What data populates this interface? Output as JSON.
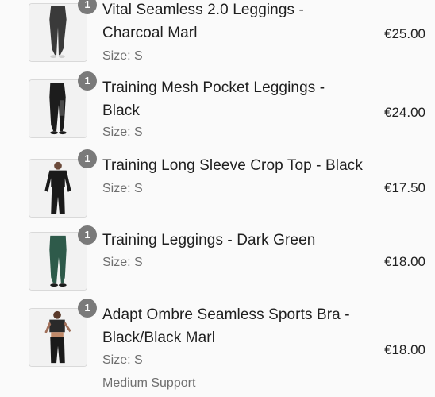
{
  "cart": {
    "items": [
      {
        "title": "Vital Seamless 2.0 Leggings - Charcoal Marl",
        "size": "Size: S",
        "price": "€25.00",
        "quantity": "1",
        "extra": ""
      },
      {
        "title": "Training Mesh Pocket Leggings - Black",
        "size": "Size: S",
        "price": "€24.00",
        "quantity": "1",
        "extra": ""
      },
      {
        "title": "Training Long Sleeve Crop Top - Black",
        "size": "Size: S",
        "price": "€17.50",
        "quantity": "1",
        "extra": ""
      },
      {
        "title": "Training Leggings - Dark Green",
        "size": "Size: S",
        "price": "€18.00",
        "quantity": "1",
        "extra": ""
      },
      {
        "title": "Adapt Ombre Seamless Sports Bra - Black/Black Marl",
        "size": "Size: S",
        "price": "€18.00",
        "quantity": "1",
        "extra": "Medium Support"
      }
    ]
  },
  "colors": {
    "badge": "#7a7a7a",
    "text": "#1f1f1f",
    "muted": "#6f6f6f",
    "leggings_charcoal": "#3a3a3a",
    "leggings_black": "#1c1c1c",
    "leggings_green": "#2e5a4a"
  }
}
